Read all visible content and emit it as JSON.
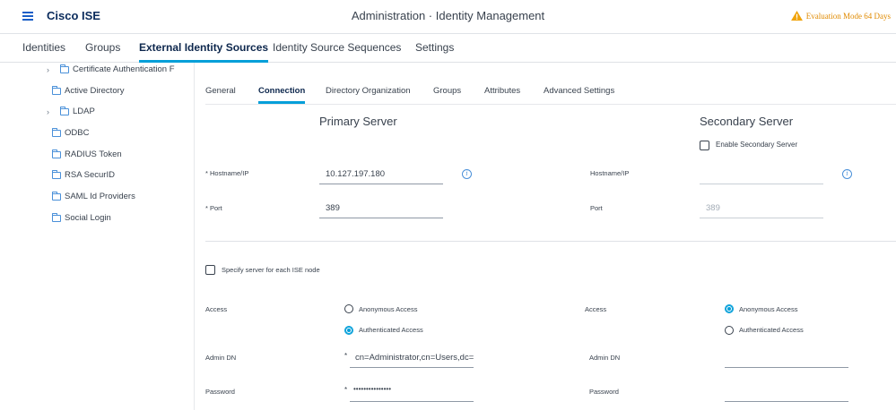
{
  "header": {
    "brand": "Cisco ISE",
    "title": "Administration · Identity Management",
    "evaluation": "Evaluation Mode 64 Days",
    "warning_color": "#e08a00"
  },
  "top_tabs": [
    {
      "label": "Identities"
    },
    {
      "label": "Groups"
    },
    {
      "label": "External Identity Sources",
      "active": true
    },
    {
      "label": "Identity Source Sequences"
    },
    {
      "label": "Settings"
    }
  ],
  "sidebar": {
    "items": [
      {
        "label": "Certificate Authentication F",
        "expandable": true
      },
      {
        "label": "Active Directory"
      },
      {
        "label": "LDAP",
        "expandable": true
      },
      {
        "label": "ODBC"
      },
      {
        "label": "RADIUS Token"
      },
      {
        "label": "RSA SecurID"
      },
      {
        "label": "SAML Id Providers"
      },
      {
        "label": "Social Login"
      }
    ]
  },
  "sub_tabs": [
    {
      "label": "General"
    },
    {
      "label": "Connection",
      "active": true
    },
    {
      "label": "Directory Organization"
    },
    {
      "label": "Groups"
    },
    {
      "label": "Attributes"
    },
    {
      "label": "Advanced Settings"
    }
  ],
  "primary": {
    "title": "Primary Server",
    "hostname_label": "* Hostname/IP",
    "hostname_value": "10.127.197.180",
    "port_label": "* Port",
    "port_value": "389"
  },
  "secondary": {
    "title": "Secondary Server",
    "enable_label": "Enable Secondary Server",
    "hostname_label": "Hostname/IP",
    "hostname_value": "",
    "port_label": "Port",
    "port_value": "389"
  },
  "specify_server_label": "Specify server for each ISE node",
  "access": {
    "label": "Access",
    "anonymous": "Anonymous Access",
    "authenticated": "Authenticated Access",
    "primary_selected": "authenticated",
    "secondary_selected": "anonymous"
  },
  "admin_dn": {
    "label": "Admin DN",
    "required_mark": "*",
    "primary_value": "cn=Administrator,cn=Users,dc=",
    "secondary_value": ""
  },
  "password": {
    "label": "Password",
    "required_mark": "*",
    "primary_value": "•••••••••••••••",
    "secondary_value": ""
  },
  "accent_color": "#049fd9"
}
